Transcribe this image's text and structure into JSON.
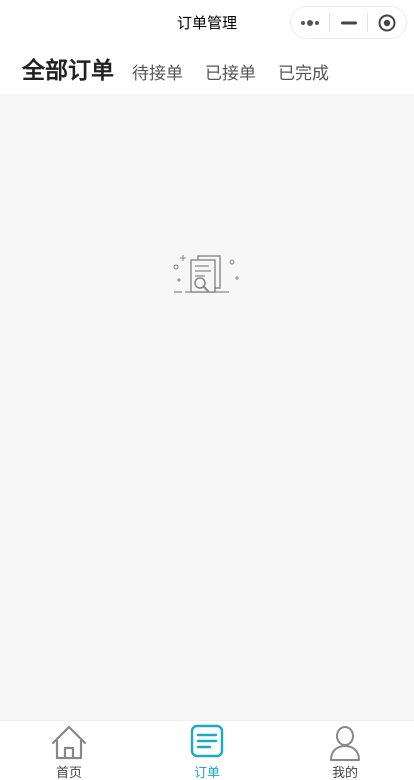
{
  "nav": {
    "title": "订单管理",
    "more_icon": "more-dots-icon",
    "minimize_icon": "minimize-icon",
    "close_icon": "target-circle-icon"
  },
  "tabs": [
    {
      "label": "全部订单",
      "active": true
    },
    {
      "label": "待接单",
      "active": false
    },
    {
      "label": "已接单",
      "active": false
    },
    {
      "label": "已完成",
      "active": false
    }
  ],
  "empty_state": {
    "icon": "empty-document-search-icon"
  },
  "tabbar": {
    "items": [
      {
        "label": "首页",
        "icon": "home-icon",
        "active": false
      },
      {
        "label": "订单",
        "icon": "order-list-icon",
        "active": true
      },
      {
        "label": "我的",
        "icon": "user-icon",
        "active": false
      }
    ]
  },
  "colors": {
    "accent": "#1aa9c6",
    "background": "#f7f7f7",
    "icon_gray": "#888888"
  }
}
